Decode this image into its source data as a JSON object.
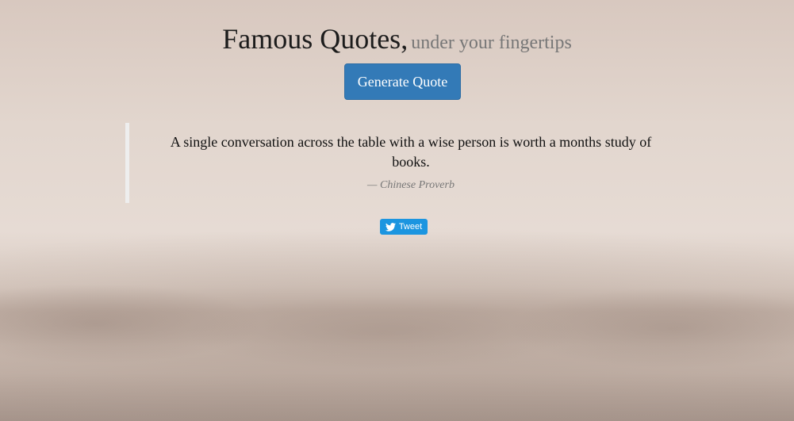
{
  "header": {
    "title": "Famous Quotes,",
    "subtitle": "under your fingertips"
  },
  "generate_button": {
    "label": "Generate Quote",
    "color": "#337ab7"
  },
  "quote": {
    "text": "A single conversation across the table with a wise person is worth a months study of books.",
    "author_line": "— Chinese Proverb"
  },
  "tweet_button": {
    "label": "Tweet",
    "icon": "twitter-bird-icon",
    "color": "#1b95e0"
  }
}
